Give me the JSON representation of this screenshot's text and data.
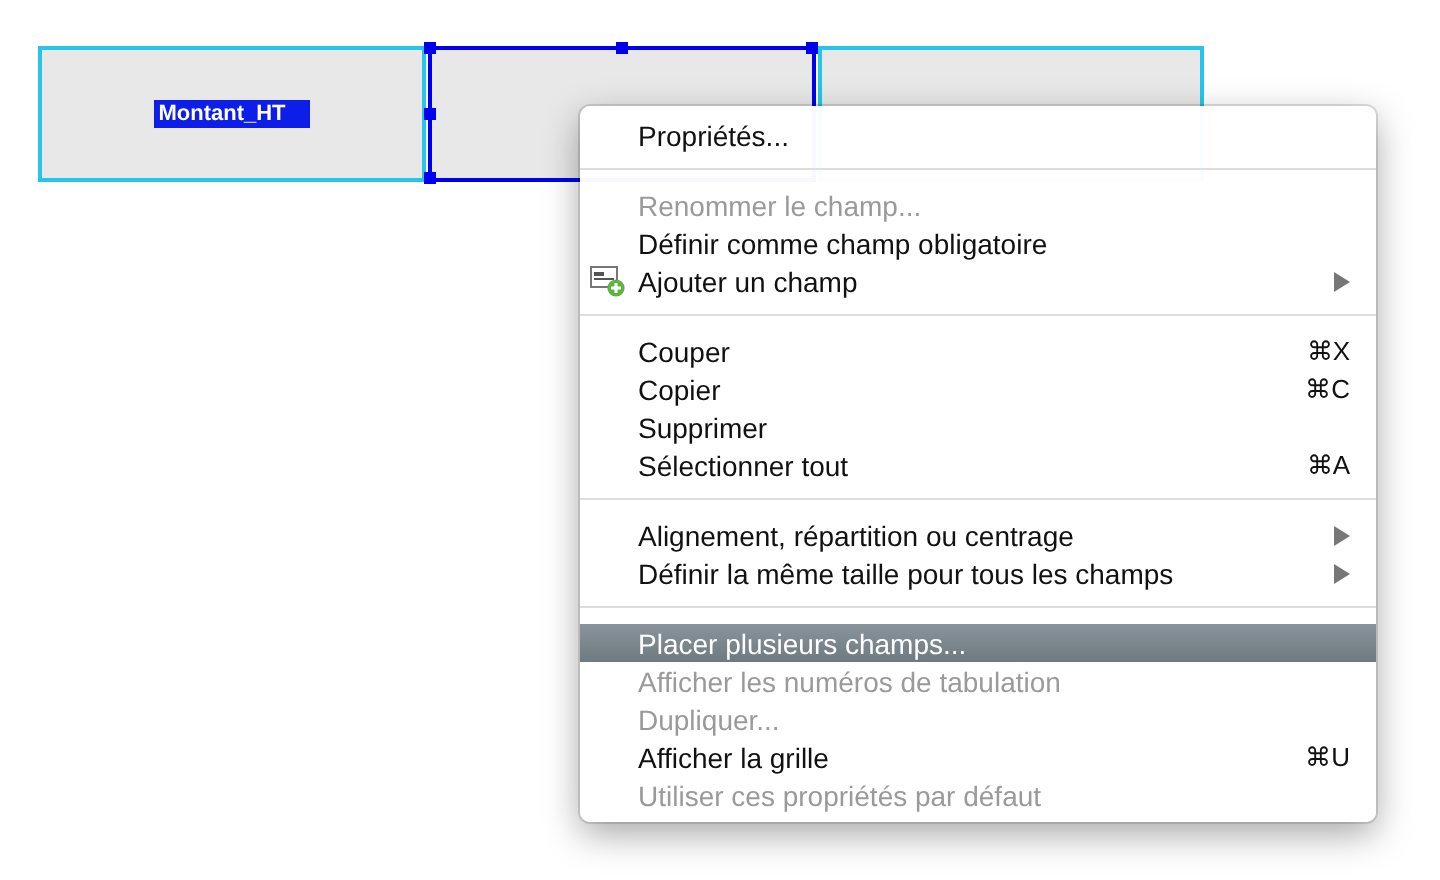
{
  "form_fields": [
    {
      "label": "Montant_HT",
      "selected": false
    },
    {
      "selected": true
    },
    {
      "selected": false
    }
  ],
  "context_menu": {
    "items": [
      {
        "kind": "item",
        "label": "Propriétés...",
        "disabled": false,
        "selected": false
      },
      {
        "kind": "separator"
      },
      {
        "kind": "item",
        "label": "Renommer le champ...",
        "disabled": true,
        "selected": false
      },
      {
        "kind": "item",
        "label": "Définir comme champ obligatoire",
        "disabled": false,
        "selected": false
      },
      {
        "kind": "icon_item",
        "label": "Ajouter un champ",
        "disabled": false,
        "selected": false,
        "submenu": true
      },
      {
        "kind": "separator"
      },
      {
        "kind": "item",
        "label": "Couper",
        "shortcut": "⌘X",
        "disabled": false,
        "selected": false
      },
      {
        "kind": "item",
        "label": "Copier",
        "shortcut": "⌘C",
        "disabled": false,
        "selected": false
      },
      {
        "kind": "item",
        "label": "Supprimer",
        "disabled": false,
        "selected": false
      },
      {
        "kind": "item",
        "label": "Sélectionner tout",
        "shortcut": "⌘A",
        "disabled": false,
        "selected": false
      },
      {
        "kind": "separator"
      },
      {
        "kind": "item",
        "label": "Alignement, répartition ou centrage",
        "disabled": false,
        "selected": false,
        "submenu": true
      },
      {
        "kind": "item",
        "label": "Définir la même taille pour tous les champs",
        "disabled": false,
        "selected": false,
        "submenu": true
      },
      {
        "kind": "separator"
      },
      {
        "kind": "item",
        "label": "Placer plusieurs champs...",
        "disabled": false,
        "selected": true
      },
      {
        "kind": "item",
        "label": "Afficher les numéros de tabulation",
        "disabled": true,
        "selected": false
      },
      {
        "kind": "item",
        "label": "Dupliquer...",
        "disabled": true,
        "selected": false
      },
      {
        "kind": "item",
        "label": "Afficher la grille",
        "shortcut": "⌘U",
        "disabled": false,
        "selected": false
      },
      {
        "kind": "item",
        "label": "Utiliser ces propriétés par défaut",
        "disabled": true,
        "selected": false
      }
    ]
  }
}
